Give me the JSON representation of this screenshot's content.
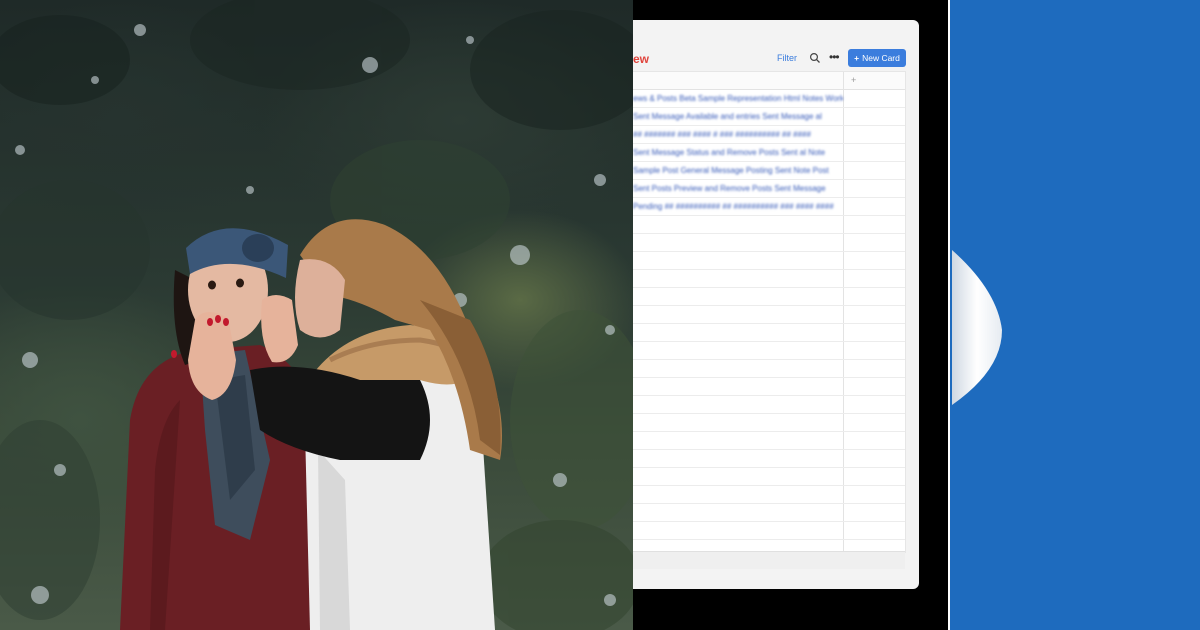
{
  "photo": {
    "description_icon": "photo-icon"
  },
  "app": {
    "view_title": "ew",
    "toolbar": {
      "filter_label": "Filter",
      "search_icon": "search-icon",
      "more_icon": "more-icon",
      "new_card_label": "New Card",
      "new_card_icon": "plus-icon"
    },
    "table": {
      "add_column_icon": "plus-icon",
      "rows": [
        "ews & Posts  Beta  Sample  Representation  Html  Notes  Work",
        "  Sent Message  Available  and  entries  Sent  Message  al",
        "  ##  #######  ###  ####  #  ###  ##########  ##  ####",
        "  Sent  Message  Status  and  Remove  Posts  Sent  al  Note",
        "  Sample  Post  General  Message  Posting  Sent  Note  Post",
        "  Sent  Posts  Preview  and  Remove  Posts  Sent  Message",
        "  Pending  ##  ##########  ##  ##########  ###  ####  ####"
      ]
    }
  },
  "colors": {
    "accent": "#3b7ddd",
    "title_red": "#e0443c",
    "blue_panel": "#1e6bbe",
    "black_panel": "#000000"
  }
}
